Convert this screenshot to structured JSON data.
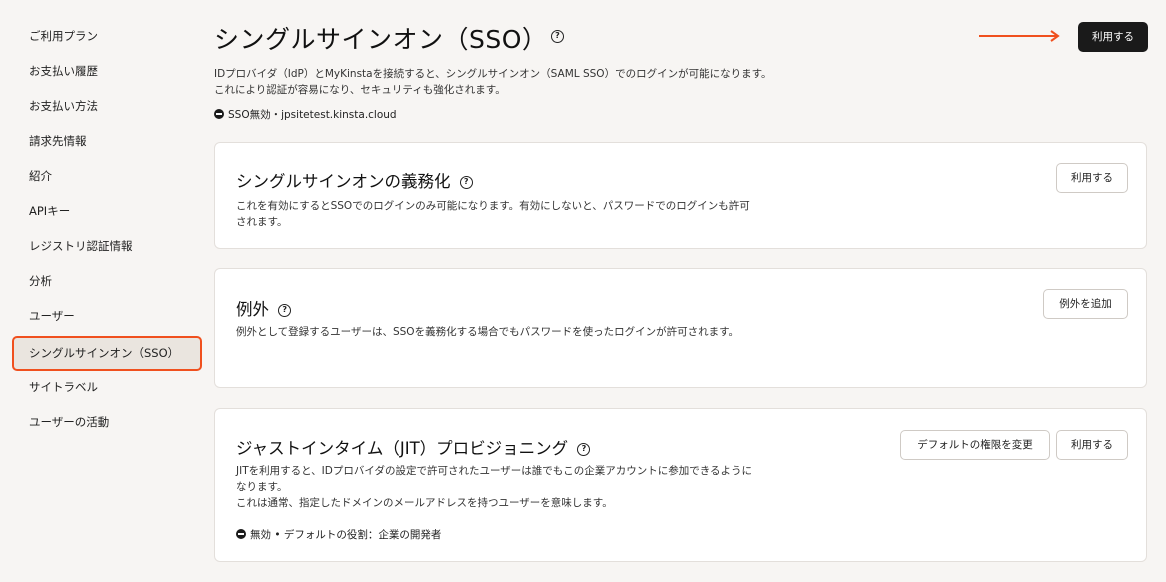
{
  "sidebar": {
    "items": [
      {
        "label": "ご利用プラン"
      },
      {
        "label": "お支払い履歴"
      },
      {
        "label": "お支払い方法"
      },
      {
        "label": "請求先情報"
      },
      {
        "label": "紹介"
      },
      {
        "label": "APIキー"
      },
      {
        "label": "レジストリ認証情報"
      },
      {
        "label": "分析"
      },
      {
        "label": "ユーザー"
      },
      {
        "label": "シングルサインオン（SSO）",
        "active": true
      },
      {
        "label": "サイトラベル"
      },
      {
        "label": "ユーザーの活動"
      }
    ]
  },
  "header": {
    "title": "シングルサインオン（SSO）",
    "help_glyph": "?",
    "enable_label": "利用する"
  },
  "intro": {
    "text": "IDプロバイダ（IdP）とMyKinstaを接続すると、シングルサインオン（SAML SSO）でのログインが可能になります。これにより認証が容易になり、セキュリティも強化されます。",
    "status": "SSO無効・jpsitetest.kinsta.cloud"
  },
  "cards": {
    "enforce": {
      "title": "シングルサインオンの義務化",
      "desc": "これを有効にするとSSOでのログインのみ可能になります。有効にしないと、パスワードでのログインも許可されます。",
      "button": "利用する"
    },
    "exceptions": {
      "title": "例外",
      "desc": "例外として登録するユーザーは、SSOを義務化する場合でもパスワードを使ったログインが許可されます。",
      "button": "例外を追加"
    },
    "jit": {
      "title": "ジャストインタイム（JIT）プロビジョニング",
      "desc1": "JITを利用すると、IDプロバイダの設定で許可されたユーザーは誰でもこの企業アカウントに参加できるようになります。",
      "desc2": "これは通常、指定したドメインのメールアドレスを持つユーザーを意味します。",
      "button_role": "デフォルトの権限を変更",
      "button_enable": "利用する",
      "status": "無効 •  デフォルトの役割：企業の開発者"
    }
  },
  "colors": {
    "accent": "#f0501e",
    "background": "#f7f5f3",
    "primary_button": "#1a1a1a"
  }
}
